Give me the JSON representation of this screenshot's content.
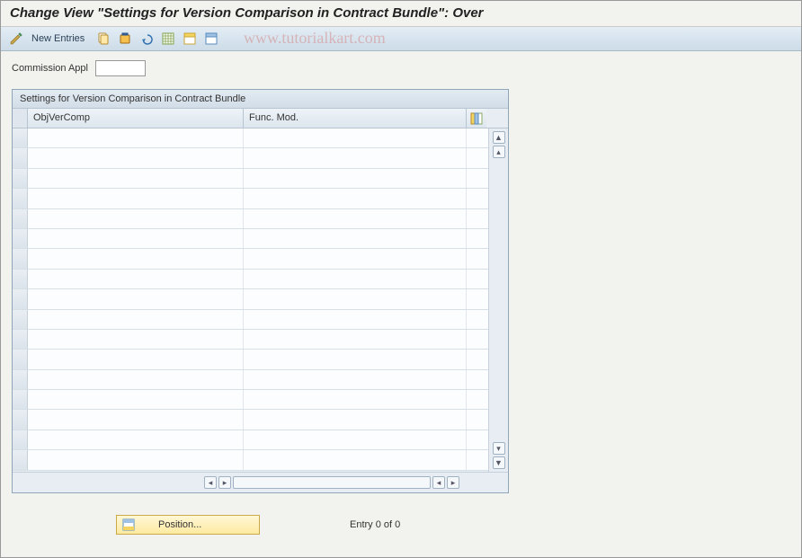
{
  "title": "Change View \"Settings for Version Comparison in Contract Bundle\": Over",
  "toolbar": {
    "new_entries_label": "New Entries",
    "watermark": "www.tutorialkart.com"
  },
  "field": {
    "commission_appl_label": "Commission Appl",
    "commission_appl_value": ""
  },
  "table": {
    "panel_title": "Settings for Version Comparison in Contract Bundle",
    "columns": {
      "obj_ver_comp": "ObjVerComp",
      "func_mod": "Func. Mod."
    },
    "rows": [
      {
        "obj_ver_comp": "",
        "func_mod": ""
      },
      {
        "obj_ver_comp": "",
        "func_mod": ""
      },
      {
        "obj_ver_comp": "",
        "func_mod": ""
      },
      {
        "obj_ver_comp": "",
        "func_mod": ""
      },
      {
        "obj_ver_comp": "",
        "func_mod": ""
      },
      {
        "obj_ver_comp": "",
        "func_mod": ""
      },
      {
        "obj_ver_comp": "",
        "func_mod": ""
      },
      {
        "obj_ver_comp": "",
        "func_mod": ""
      },
      {
        "obj_ver_comp": "",
        "func_mod": ""
      },
      {
        "obj_ver_comp": "",
        "func_mod": ""
      },
      {
        "obj_ver_comp": "",
        "func_mod": ""
      },
      {
        "obj_ver_comp": "",
        "func_mod": ""
      },
      {
        "obj_ver_comp": "",
        "func_mod": ""
      },
      {
        "obj_ver_comp": "",
        "func_mod": ""
      },
      {
        "obj_ver_comp": "",
        "func_mod": ""
      },
      {
        "obj_ver_comp": "",
        "func_mod": ""
      },
      {
        "obj_ver_comp": "",
        "func_mod": ""
      }
    ]
  },
  "footer": {
    "position_label": "Position...",
    "entry_text": "Entry 0 of 0"
  }
}
